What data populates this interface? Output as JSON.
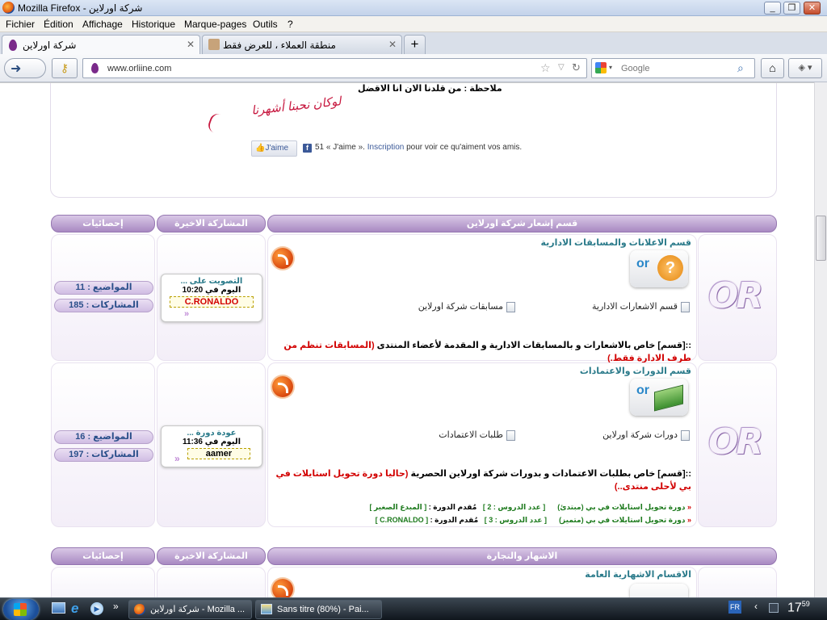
{
  "window": {
    "title": "شركة اورلاين - Mozilla Firefox"
  },
  "menu": [
    "Fichier",
    "Édition",
    "Affichage",
    "Historique",
    "Marque-pages",
    "Outils",
    "?"
  ],
  "tabs": [
    {
      "label": "شركة اورلاين"
    },
    {
      "label": "منطقة العملاء ، للعرض فقط"
    }
  ],
  "nav": {
    "url": "www.orliine.com",
    "search_placeholder": "Google"
  },
  "top_panel": {
    "note": "ملاحظة : من قلدنا الان انا الاقضل",
    "slogan": "لوكان نحبنا أشهرنا",
    "like_button": "J'aime",
    "like_text": "51 « J'aime ». ",
    "inscription": "Inscription",
    "like_tail": " pour voir ce qu'aiment vos amis."
  },
  "section1": {
    "header_main": "قسم إشعار شركة اورلاين",
    "header_last": "المشاركة الاخيرة",
    "header_stats": "إحصائيات",
    "forums": [
      {
        "title": "قسم الاعلانات والمسابقات الادارية",
        "subforums": [
          "قسم الاشعارات الادارية",
          "مسابقات شركة اورلاين"
        ],
        "desc_prefix": "::[قسم] خاص بالاشعارات و بالمسابقات الادارية و المقدمة لأعضاء المنتدى ",
        "desc_red": "(المسابقات تنظم من طرف الادارة فقط.)",
        "topics": "المواضيع : 11",
        "posts": "المشاركات : 185",
        "last_title": "التصويت على ...",
        "last_date": "اليوم في 10:20",
        "last_user": "C.RONALDO"
      },
      {
        "title": "قسم الدورات والاعتمادات",
        "subforums": [
          "دورات شركة اورلاين",
          "طلبات الاعتمادات"
        ],
        "desc_prefix": "::[قسم] خاص بطلبات الاعتمادات و بدورات شركة اورلاين الحصرية ",
        "desc_red": "(حاليا دورة تحويل استايلات في بي لأحلى منتدى..)",
        "topics": "المواضيع : 16",
        "posts": "المشاركات : 197",
        "last_title": "عودة دورة ...",
        "last_date": "اليوم في 11:36",
        "last_user": "aamer",
        "courses": [
          {
            "name": "دورة تحويل استايلات في بي (مبتدئ)",
            "lessons": "[ عدد الدروس : 2 ]",
            "presenter_label": "مُقدم الدورة : ",
            "presenter": "[ المبدع الصغير ]"
          },
          {
            "name": "دورة تحويل استايلات في بي (متميز)",
            "lessons": "[ عدد الدروس : 3 ]",
            "presenter_label": "مُقدم الدورة : ",
            "presenter": "[ C.RONALDO ]"
          }
        ]
      }
    ]
  },
  "section2": {
    "header_main": "الاشهار والتجارة",
    "header_last": "المشاركة الاخيرة",
    "header_stats": "إحصائيات",
    "forum_title": "الاقسام الاشهارية العامة"
  },
  "taskbar": {
    "items": [
      "شركة اورلاين - Mozilla ...",
      "Sans titre (80%) - Pai..."
    ],
    "lang": "FR",
    "time_hour": "17",
    "time_min": "59"
  },
  "colors": {
    "accent": "#a889c2",
    "link": "#2a7a8a",
    "alert": "#d20000"
  }
}
